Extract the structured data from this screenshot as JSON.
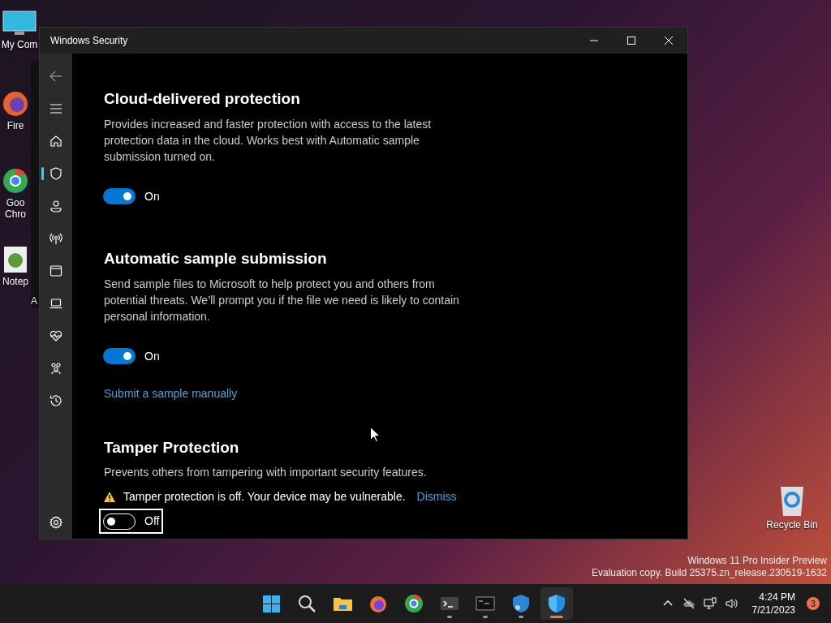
{
  "desktop": {
    "icons": [
      {
        "label": "My Com"
      },
      {
        "label": "Fire"
      },
      {
        "label": "Goo\nChro"
      },
      {
        "label": "Notep"
      }
    ],
    "behind_window_text": "A",
    "recycle_bin": "Recycle Bin",
    "watermark": [
      "Windows 11 Pro Insider Preview",
      "Evaluation copy. Build 25375.zn_release.230519-1632"
    ]
  },
  "window": {
    "title": "Windows Security"
  },
  "nav": [
    {
      "selected": false
    },
    {
      "selected": true
    },
    {
      "selected": false
    },
    {
      "selected": false
    },
    {
      "selected": false
    },
    {
      "selected": false
    },
    {
      "selected": false
    },
    {
      "selected": false
    },
    {
      "selected": false
    }
  ],
  "sections": [
    {
      "title": "Cloud-delivered protection",
      "description": "Provides increased and faster protection with access to the latest protection data in the cloud. Works best with Automatic sample submission turned on.",
      "toggle": {
        "on": true,
        "focused": false,
        "label": "On"
      }
    },
    {
      "title": "Automatic sample submission",
      "description": "Send sample files to Microsoft to help protect you and others from potential threats. We’ll prompt you if the file we need is likely to contain personal information.",
      "toggle": {
        "on": true,
        "focused": false,
        "label": "On"
      },
      "link": "Submit a sample manually"
    },
    {
      "title": "Tamper Protection",
      "description": "Prevents others from tampering with important security features.",
      "warning": {
        "text": "Tamper protection is off. Your device may be vulnerable.",
        "action": "Dismiss"
      },
      "toggle": {
        "on": false,
        "focused": true,
        "label": "Off"
      }
    }
  ],
  "taskbar": {
    "apps": [
      {
        "running": false,
        "selected": false
      },
      {
        "running": false,
        "selected": false
      },
      {
        "running": false,
        "selected": false
      },
      {
        "running": false,
        "selected": false
      },
      {
        "running": false,
        "selected": false
      },
      {
        "running": true,
        "selected": false
      },
      {
        "running": true,
        "selected": false
      },
      {
        "running": true,
        "selected": false
      },
      {
        "running": true,
        "selected": true
      }
    ],
    "time": "4:24 PM",
    "date": "7/21/2023",
    "notifications": "3"
  }
}
